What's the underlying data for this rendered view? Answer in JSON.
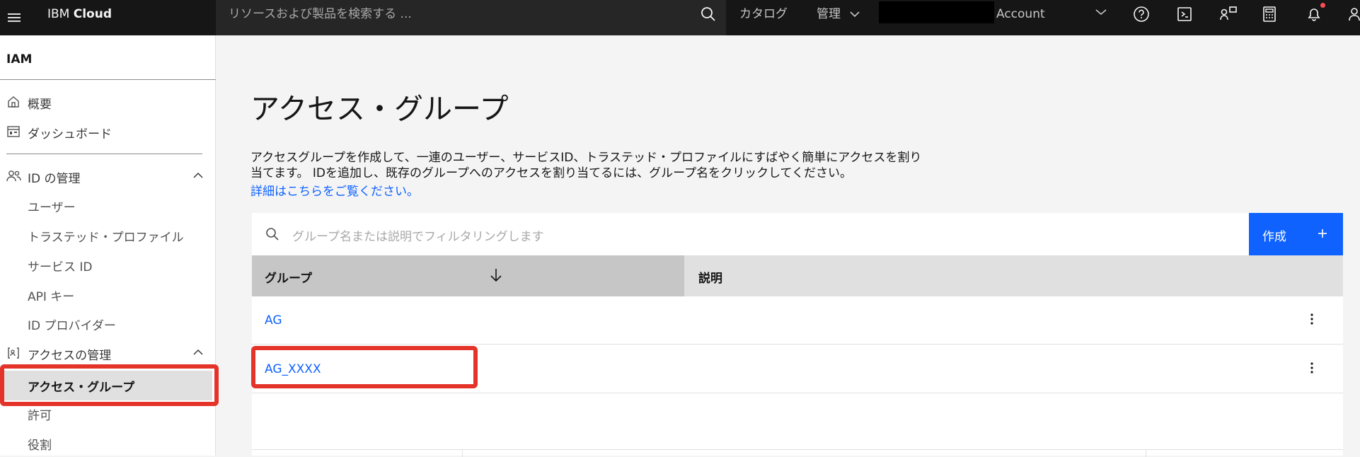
{
  "header": {
    "brand_prefix": "IBM",
    "brand_name": "Cloud",
    "search_placeholder": "リソースおよび製品を検索する ...",
    "nav": [
      "カタログ",
      "管理"
    ],
    "account_label": "Account",
    "icons": [
      "help-icon",
      "terminal-icon",
      "cost-estimator-icon",
      "calculator-icon",
      "notification-icon",
      "user-icon"
    ]
  },
  "sidebar": {
    "title": "IAM",
    "items": [
      {
        "label": "概要",
        "icon": "home-icon"
      },
      {
        "label": "ダッシュボード",
        "icon": "dashboard-icon"
      }
    ],
    "sections": [
      {
        "label": "ID の管理",
        "icon": "user-group-icon",
        "children": [
          "ユーザー",
          "トラステッド・プロファイル",
          "サービス ID",
          "API キー",
          "ID プロバイダー"
        ]
      },
      {
        "label": "アクセスの管理",
        "icon": "access-icon",
        "children": [
          "アクセス・グループ",
          "許可",
          "役割"
        ],
        "active_child": "アクセス・グループ"
      }
    ]
  },
  "main": {
    "title": "アクセス・グループ",
    "description_line1": "アクセスグループを作成して、一連のユーザー、サービスID、トラステッド・プロファイルにすばやく簡単にアクセスを割り",
    "description_line2": "当てます。 IDを追加し、既存のグループへのアクセスを割り当てるには、グループ名をクリックしてください。",
    "learn_more_link": "詳細はこちらをご覧ください。",
    "filter_placeholder": "グループ名または説明でフィルタリングします",
    "create_button": "作成",
    "table": {
      "columns": [
        "グループ",
        "説明"
      ],
      "sort_column": "グループ",
      "rows": [
        {
          "name": "AG",
          "description": ""
        },
        {
          "name": "AG_XXXX",
          "description": ""
        }
      ]
    }
  },
  "colors": {
    "header_bg": "#161616",
    "accent": "#0f62fe",
    "highlight": "#e4342a"
  }
}
